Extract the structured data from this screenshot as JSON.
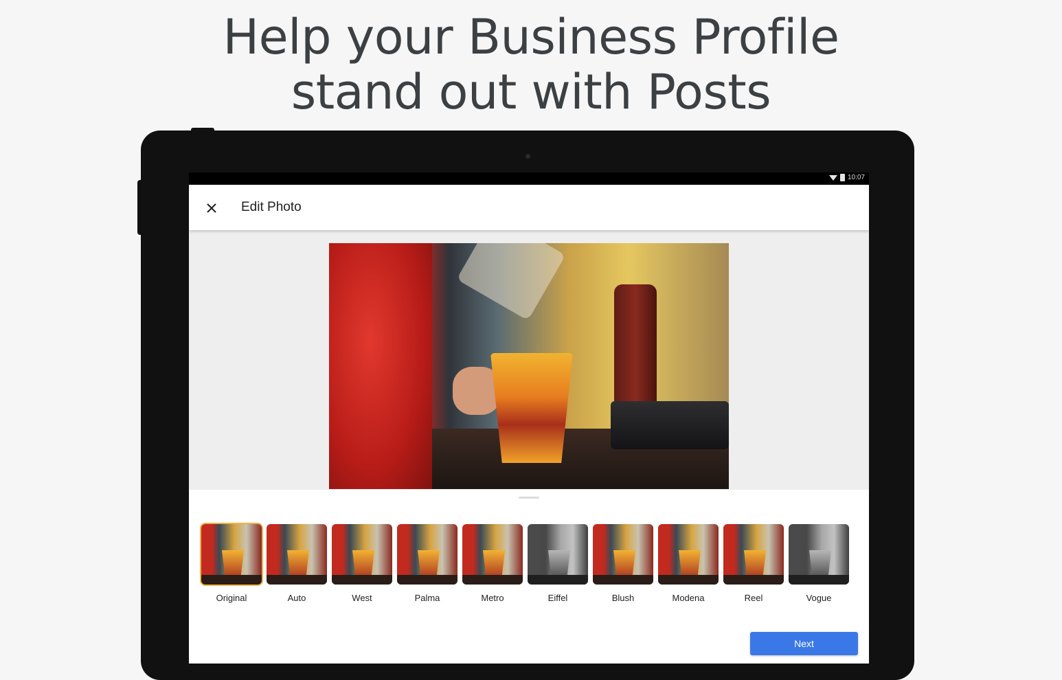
{
  "headline": {
    "line1": "Help your Business Profile",
    "line2": "stand out with Posts"
  },
  "statusbar": {
    "time": "10:07",
    "icons": [
      "wifi-icon",
      "battery-icon"
    ]
  },
  "appbar": {
    "close_icon": "close-icon",
    "title": "Edit Photo"
  },
  "filters": [
    {
      "label": "Original",
      "selected": true
    },
    {
      "label": "Auto"
    },
    {
      "label": "West"
    },
    {
      "label": "Palma"
    },
    {
      "label": "Metro"
    },
    {
      "label": "Eiffel",
      "bw": true
    },
    {
      "label": "Blush"
    },
    {
      "label": "Modena"
    },
    {
      "label": "Reel"
    },
    {
      "label": "Vogue",
      "bw": true
    }
  ],
  "actions": {
    "next_label": "Next"
  },
  "colors": {
    "accent": "#3b78e7",
    "headline": "#3c4043",
    "selected_outline": "#f0b24a"
  }
}
